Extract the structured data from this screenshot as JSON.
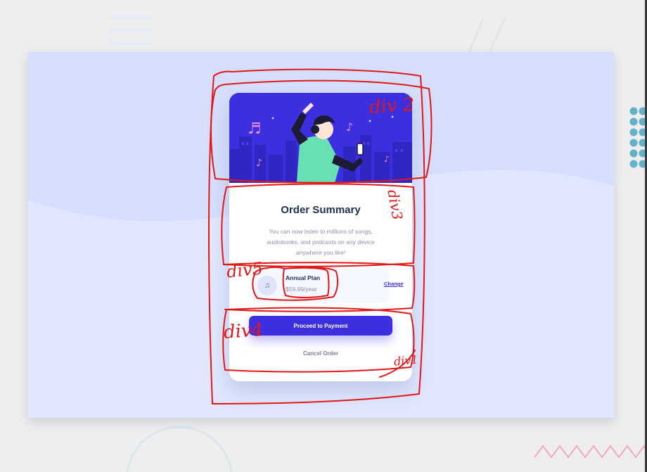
{
  "card": {
    "title": "Order Summary",
    "description": "You can now listen to millions of songs, audiobooks, and podcasts on any device anywhere you like!"
  },
  "plan": {
    "icon": "music-note-icon",
    "name": "Annual Plan",
    "price": "$59.99/year",
    "change_label": "Change"
  },
  "actions": {
    "pay_label": "Proceed to Payment",
    "cancel_label": "Cancel Order"
  },
  "annotations": {
    "hero_label": "div 2",
    "content_label": "div3",
    "plan_label": "div5",
    "actions_label": "div4",
    "card_label": "div1"
  },
  "colors": {
    "accent": "#3b2fe0",
    "annotation": "#e01818",
    "slide_background": "#dfe6fd",
    "title": "#1f2f56"
  }
}
